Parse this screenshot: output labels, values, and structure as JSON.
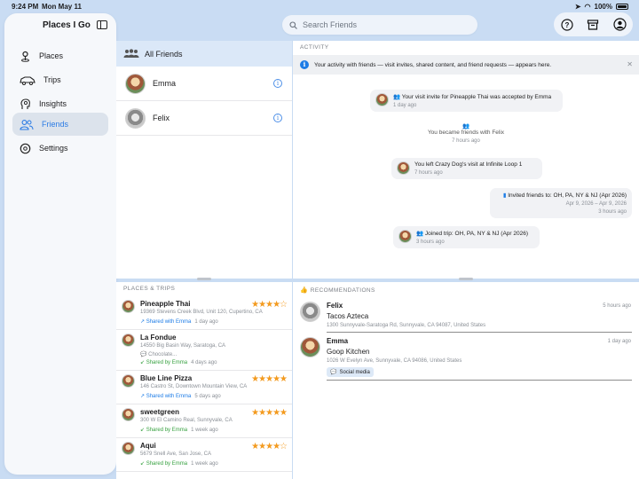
{
  "status": {
    "time": "9:24 PM",
    "date": "Mon May 11",
    "battery": "100%"
  },
  "sidebar": {
    "title": "Places I Go",
    "items": [
      {
        "label": "Places",
        "icon": "pin-icon",
        "active": false
      },
      {
        "label": "Trips",
        "icon": "car-icon",
        "active": false
      },
      {
        "label": "Insights",
        "icon": "head-icon",
        "active": false
      },
      {
        "label": "Friends",
        "icon": "people-icon",
        "active": true
      },
      {
        "label": "Settings",
        "icon": "gear-icon",
        "active": false
      }
    ]
  },
  "search": {
    "placeholder": "Search Friends"
  },
  "friends": {
    "header": "All Friends",
    "items": [
      {
        "name": "Emma"
      },
      {
        "name": "Felix"
      }
    ]
  },
  "activity": {
    "label": "ACTIVITY",
    "banner": "Your activity with friends — visit invites, shared content, and friend requests — appears here.",
    "entries": [
      {
        "text": "Your visit invite for Pineapple Thai was accepted by Emma",
        "time": "1 day ago"
      },
      {
        "text": "You became friends with Felix",
        "time": "7 hours ago"
      },
      {
        "text": "You left Crazy Dog's visit at Infinite Loop 1",
        "time": "7 hours ago"
      },
      {
        "text": "Invited friends to: OH, PA, NY & NJ (Apr 2026)",
        "sub": "Apr 9, 2026 – Apr 9, 2026",
        "time": "3 hours ago"
      },
      {
        "text": "Joined trip: OH, PA, NY & NJ (Apr 2026)",
        "time": "3 hours ago"
      }
    ]
  },
  "places": {
    "label": "PLACES & TRIPS",
    "items": [
      {
        "name": "Pineapple Thai",
        "address": "19369 Stevens Creek Blvd, Unit 120, Cupertino, CA",
        "share": "Shared with Emma",
        "when": "1 day ago",
        "stars": "★★★★☆",
        "dir": "out"
      },
      {
        "name": "La Fondue",
        "address": "14550 Big Basin Way, Saratoga, CA",
        "note": "Chocolate...",
        "share": "Shared by Emma",
        "when": "4 days ago",
        "stars": "",
        "dir": "in"
      },
      {
        "name": "Blue Line Pizza",
        "address": "146 Castro St, Downtown Mountain View, CA",
        "share": "Shared with Emma",
        "when": "5 days ago",
        "stars": "★★★★★",
        "dir": "out"
      },
      {
        "name": "sweetgreen",
        "address": "300 W El Camino Real, Sunnyvale, CA",
        "share": "Shared by Emma",
        "when": "1 week ago",
        "stars": "★★★★★",
        "dir": "in"
      },
      {
        "name": "Aqui",
        "address": "5679 Snell Ave, San Jose, CA",
        "share": "Shared by Emma",
        "when": "1 week ago",
        "stars": "★★★★☆",
        "dir": "in"
      }
    ]
  },
  "recommendations": {
    "label": "RECOMMENDATIONS",
    "items": [
      {
        "friend": "Felix",
        "place": "Tacos Azteca",
        "address": "1300 Sunnyvale-Saratoga Rd, Sunnyvale, CA 94087, United States",
        "when": "5 hours ago"
      },
      {
        "friend": "Emma",
        "place": "Goop Kitchen",
        "address": "1026 W Evelyn Ave, Sunnyvale, CA 94086, United States",
        "when": "1 day ago",
        "tag": "Social media"
      }
    ]
  }
}
